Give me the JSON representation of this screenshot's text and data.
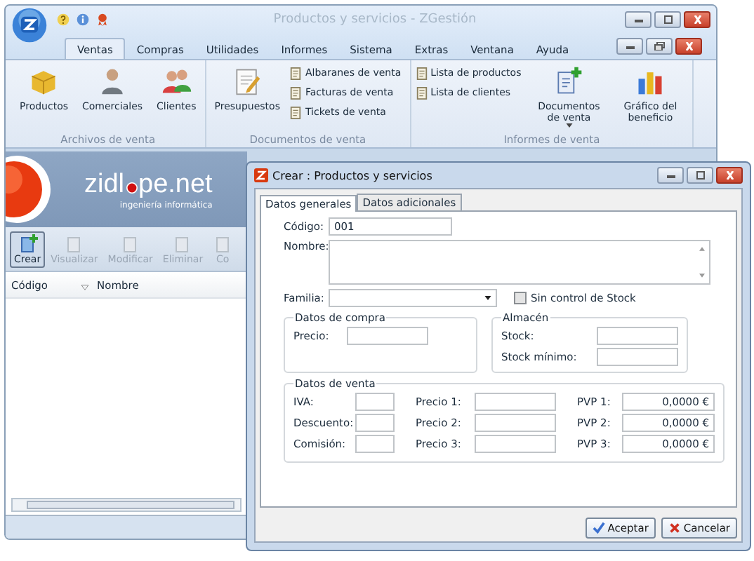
{
  "window": {
    "title": "Productos y servicios - ZGestión"
  },
  "menu_tabs": [
    {
      "label": "Ventas",
      "selected": true
    },
    {
      "label": "Compras",
      "selected": false
    },
    {
      "label": "Utilidades",
      "selected": false
    },
    {
      "label": "Informes",
      "selected": false
    },
    {
      "label": "Sistema",
      "selected": false
    },
    {
      "label": "Extras",
      "selected": false
    },
    {
      "label": "Ventana",
      "selected": false
    },
    {
      "label": "Ayuda",
      "selected": false
    }
  ],
  "ribbon_groups": [
    {
      "title": "Archivos de venta",
      "items": [
        {
          "label": "Productos",
          "kind": "large"
        },
        {
          "label": "Comerciales",
          "kind": "large"
        },
        {
          "label": "Clientes",
          "kind": "large"
        }
      ]
    },
    {
      "title": "Documentos de venta",
      "items": [
        {
          "label": "Presupuestos",
          "kind": "large"
        },
        {
          "label": "Albaranes de venta",
          "kind": "small"
        },
        {
          "label": "Facturas de venta",
          "kind": "small"
        },
        {
          "label": "Tickets de venta",
          "kind": "small"
        }
      ]
    },
    {
      "title": "Informes de venta",
      "items": [
        {
          "label": "Lista de productos",
          "kind": "small"
        },
        {
          "label": "Lista de clientes",
          "kind": "small"
        },
        {
          "label": "Documentos de venta",
          "kind": "dropdown"
        },
        {
          "label": "Gráfico del beneficio",
          "kind": "large"
        }
      ]
    }
  ],
  "banner": {
    "logo_start": "zidl",
    "logo_end": "pe.net",
    "tagline": "ingeniería informática"
  },
  "toolbar": [
    {
      "label": "Crear",
      "disabled": false
    },
    {
      "label": "Visualizar",
      "disabled": true
    },
    {
      "label": "Modificar",
      "disabled": true
    },
    {
      "label": "Eliminar",
      "disabled": true
    },
    {
      "label": "Co",
      "disabled": true
    }
  ],
  "list_columns": [
    "Código",
    "Nombre"
  ],
  "dialog": {
    "title": "Crear : Productos y servicios",
    "tabs": [
      {
        "label": "Datos generales",
        "selected": true
      },
      {
        "label": "Datos adicionales",
        "selected": false
      }
    ],
    "codigo": {
      "label": "Código:",
      "value": "001"
    },
    "nombre": {
      "label": "Nombre:"
    },
    "familia": {
      "label": "Familia:"
    },
    "stock_control": {
      "label": "Sin control de Stock",
      "checked": false
    },
    "compra": {
      "title": "Datos de compra",
      "fields": [
        {
          "label": "Precio:"
        }
      ]
    },
    "almacen": {
      "title": "Almacén",
      "fields": [
        {
          "label": "Stock:"
        },
        {
          "label": "Stock mínimo:"
        }
      ]
    },
    "venta": {
      "title": "Datos de venta",
      "columns": [
        [
          {
            "label": "IVA:"
          },
          {
            "label": "Descuento:"
          },
          {
            "label": "Comisión:"
          }
        ],
        [
          {
            "label": "Precio 1:"
          },
          {
            "label": "Precio 2:"
          },
          {
            "label": "Precio 3:"
          }
        ],
        [
          {
            "label": "PVP 1:",
            "value": "0,0000 €"
          },
          {
            "label": "PVP 2:",
            "value": "0,0000 €"
          },
          {
            "label": "PVP 3:",
            "value": "0,0000 €"
          }
        ]
      ]
    },
    "buttons": [
      "Aceptar",
      "Cancelar"
    ]
  }
}
